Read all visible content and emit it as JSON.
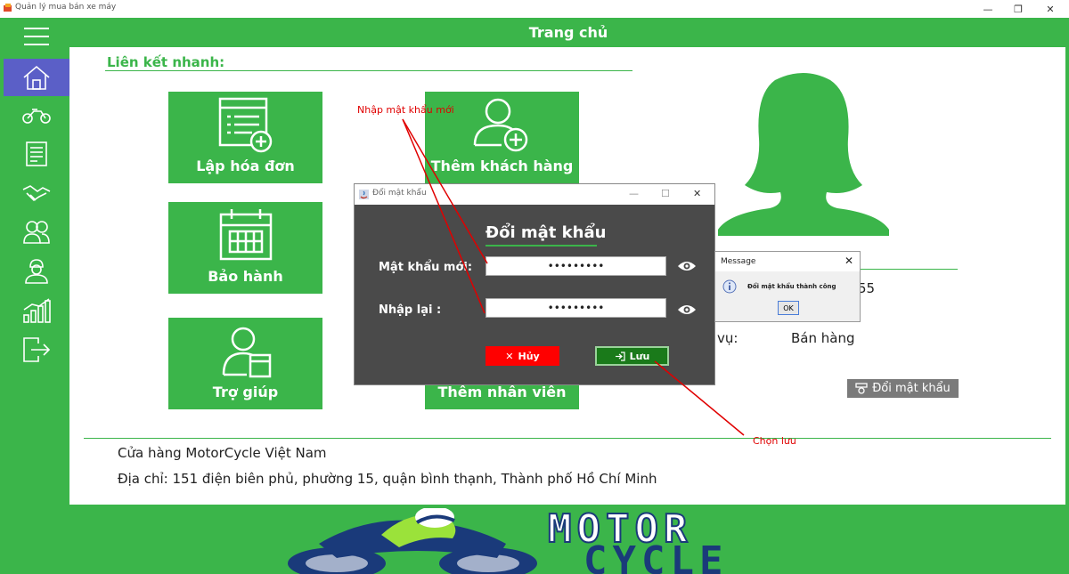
{
  "window": {
    "title": "Quản lý mua bán xe máy",
    "controls": [
      "—",
      "❐",
      "✕"
    ]
  },
  "header": {
    "title": "Trang chủ"
  },
  "sidebar": {
    "items": [
      {
        "icon": "menu-icon"
      },
      {
        "icon": "home-icon",
        "active": true
      },
      {
        "icon": "motorbike-icon"
      },
      {
        "icon": "invoice-icon"
      },
      {
        "icon": "handshake-icon"
      },
      {
        "icon": "customers-icon"
      },
      {
        "icon": "staff-icon"
      },
      {
        "icon": "statistics-icon"
      },
      {
        "icon": "logout-icon"
      }
    ]
  },
  "quick_links": {
    "title": "Liên kết nhanh:",
    "tiles": [
      {
        "label": "Lập hóa đơn",
        "icon": "invoice-add-icon"
      },
      {
        "label": "Thêm khách hàng",
        "icon": "user-add-icon"
      },
      {
        "label": "Bảo hành",
        "icon": "calendar-icon"
      },
      {
        "label": "Trợ giúp",
        "icon": "help-user-icon"
      },
      {
        "label": "Thêm nhân viên",
        "icon": "staff-add-icon"
      }
    ]
  },
  "profile": {
    "avatar_icon": "user-silhouette-icon",
    "partial_value": "55",
    "role_label": "vụ:",
    "role_value": "Bán hàng",
    "change_password_label": "Đổi mật khẩu"
  },
  "store": {
    "name": "Cửa hàng MotorCycle Việt Nam",
    "address": "Địa chỉ: 151 điện biên phủ, phường 15, quận bình thạnh, Thành phố Hồ Chí Minh"
  },
  "banner": {
    "line1": "MOTOR",
    "line2": "CYCLE"
  },
  "dialog": {
    "title": "Đổi mật khẩu",
    "heading": "Đổi mật khẩu",
    "new_password_label": "Mật khẩu mới:",
    "new_password_value": "•••••••••",
    "confirm_label": "Nhập lại :",
    "confirm_value": "•••••••••",
    "cancel_label": "Hủy",
    "save_label": "Lưu",
    "controls": [
      "—",
      "☐",
      "✕"
    ]
  },
  "message_box": {
    "title": "Message",
    "text": "Đổi mật khẩu thành công",
    "ok_label": "OK",
    "close": "✕"
  },
  "annotations": {
    "top": "Nhập mật khẩu mới",
    "bottom": "Chọn lưu"
  },
  "colors": {
    "brand_green": "#3bb54a",
    "active_nav": "#5b5fc7",
    "dialog_bg": "#4a4a4a",
    "cancel_red": "#ff0000",
    "save_green": "#1a7a1a",
    "annotation_red": "#e00000"
  }
}
